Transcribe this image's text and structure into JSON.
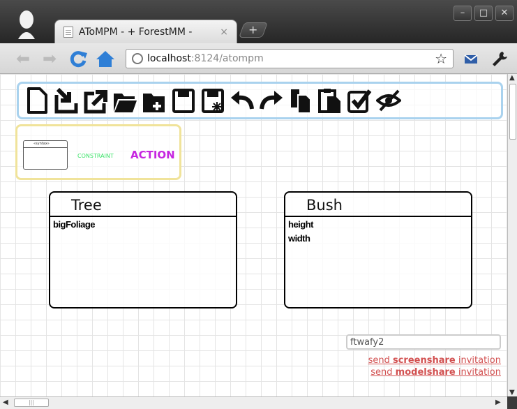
{
  "browser": {
    "tab_title": "AToMPM - + ForestMM -",
    "tab_close": "×",
    "new_tab": "+",
    "window_buttons": [
      "–",
      "□",
      "✕"
    ],
    "url_host": "localhost",
    "url_path": ":8124/atompm"
  },
  "toolbar_icons": [
    "new-file-icon",
    "load-icon",
    "export-icon",
    "open-folder-icon",
    "add-folder-icon",
    "save-icon",
    "save-as-icon",
    "undo-icon",
    "redo-icon",
    "copy-icon",
    "paste-icon",
    "validate-icon",
    "toggle-visibility-icon"
  ],
  "palette": {
    "mini_label": "«syntax»",
    "constraint": "CONSTRAINT",
    "action": "ACTION"
  },
  "classes": [
    {
      "name": "Tree",
      "attributes": [
        "bigFoliage"
      ]
    },
    {
      "name": "Bush",
      "attributes": [
        "height",
        "width"
      ]
    }
  ],
  "share": {
    "input_value": "ftwafy2",
    "screenshare_prefix": "send ",
    "screenshare_bold": "screenshare",
    "screenshare_suffix": " invitation",
    "modelshare_prefix": "send ",
    "modelshare_bold": "modelshare",
    "modelshare_suffix": " invitation"
  },
  "colors": {
    "toolbar_border": "#a9d2ee",
    "palette_border": "#f0e39a",
    "constraint": "#3de36a",
    "action": "#c626e0",
    "share_link": "#d25050"
  }
}
